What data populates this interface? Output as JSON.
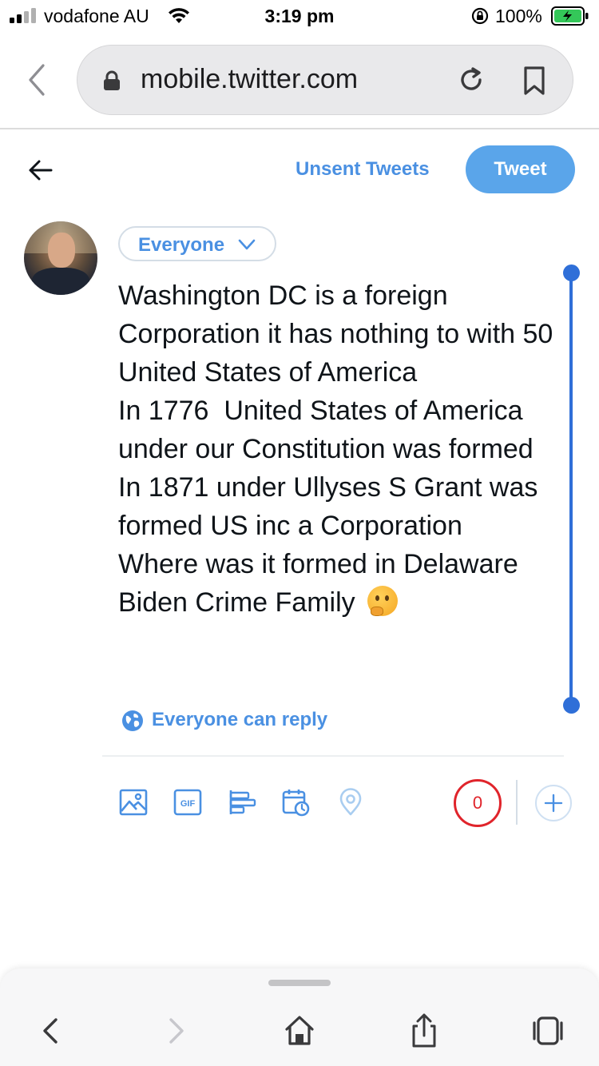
{
  "status_bar": {
    "carrier": "vodafone AU",
    "time": "3:19 pm",
    "battery": "100%"
  },
  "browser": {
    "url": "mobile.twitter.com"
  },
  "compose": {
    "unsent_label": "Unsent Tweets",
    "tweet_button": "Tweet",
    "audience": "Everyone",
    "text": "Washington DC is a foreign Corporation it has nothing to with 50 United States of America\nIn 1776  United States of America under our Constitution was formed\nIn 1871 under Ullyses S Grant was formed US inc a Corporation\nWhere was it formed in Delaware\nBiden Crime Family",
    "emoji": "thinking-face",
    "reply_setting": "Everyone can reply",
    "char_counter": "0"
  },
  "toolbar": {
    "icons": [
      "image-icon",
      "gif-icon",
      "poll-icon",
      "schedule-icon",
      "location-icon",
      "add-icon"
    ]
  },
  "colors": {
    "accent": "#4a90e2",
    "tweet_button": "#5aa5ea",
    "counter_red": "#e0242b",
    "scrollbar": "#2f6fd8"
  }
}
